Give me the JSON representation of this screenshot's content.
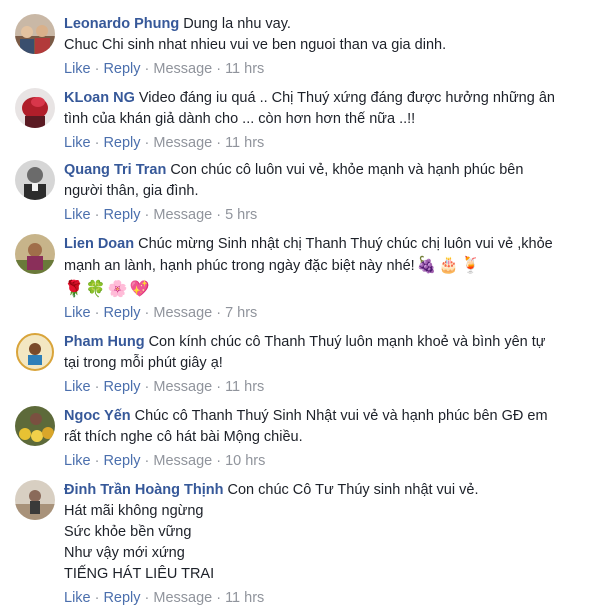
{
  "actions": {
    "like": "Like",
    "reply": "Reply",
    "message": "Message",
    "separator": "·"
  },
  "colors": {
    "author": "#365899",
    "link": "#4b6fad",
    "meta": "#90949c",
    "text": "#1d2129"
  },
  "comments": [
    {
      "author": "Leonardo Phung",
      "text": "Dung la nhu vay.\nChuc Chi sinh nhat nhieu vui ve ben nguoi than va gia dinh.",
      "time": "11 hrs"
    },
    {
      "author": "KLoan NG",
      "text": "Video đáng iu quá .. Chị Thuý xứng đáng được hưởng những ân tình của khán giả dành cho ... còn hơn hơn thế nữa ..!!",
      "time": "11 hrs"
    },
    {
      "author": "Quang Tri Tran",
      "text": "Con chúc cô luôn vui vẻ, khỏe mạnh và hạnh phúc bên người thân, gia đình.",
      "time": "5 hrs"
    },
    {
      "author": "Lien Doan",
      "text": "Chúc mừng Sinh nhật chị Thanh Thuý chúc chị luôn vui vẻ ,khỏe mạnh an lành, hạnh phúc trong ngày đặc biệt này nhé!",
      "emojis_inline": "🍇🎂🍹",
      "emojis_line": "🌹🍀🌸💖",
      "time": "7 hrs"
    },
    {
      "author": "Pham Hung",
      "text": "Con kính chúc cô Thanh Thuý luôn mạnh khoẻ và bình yên tự tại trong mỗi phút giây ạ!",
      "time": "11 hrs"
    },
    {
      "author": "Ngoc Yến",
      "text": "Chúc cô Thanh Thuý Sinh Nhật vui vẻ và hạnh phúc bên GĐ em rất thích nghe cô hát bài Mộng chiều.",
      "time": "10 hrs"
    },
    {
      "author": "Đinh Trần Hoàng Thịnh",
      "text": "Con chúc Cô Tư Thúy sinh nhật vui vẻ.\nHát mãi không ngừng\nSức khỏe bền vững\nNhư vậy mới xứng\nTIẾNG HÁT LIÊU TRAI",
      "time": "11 hrs"
    }
  ]
}
